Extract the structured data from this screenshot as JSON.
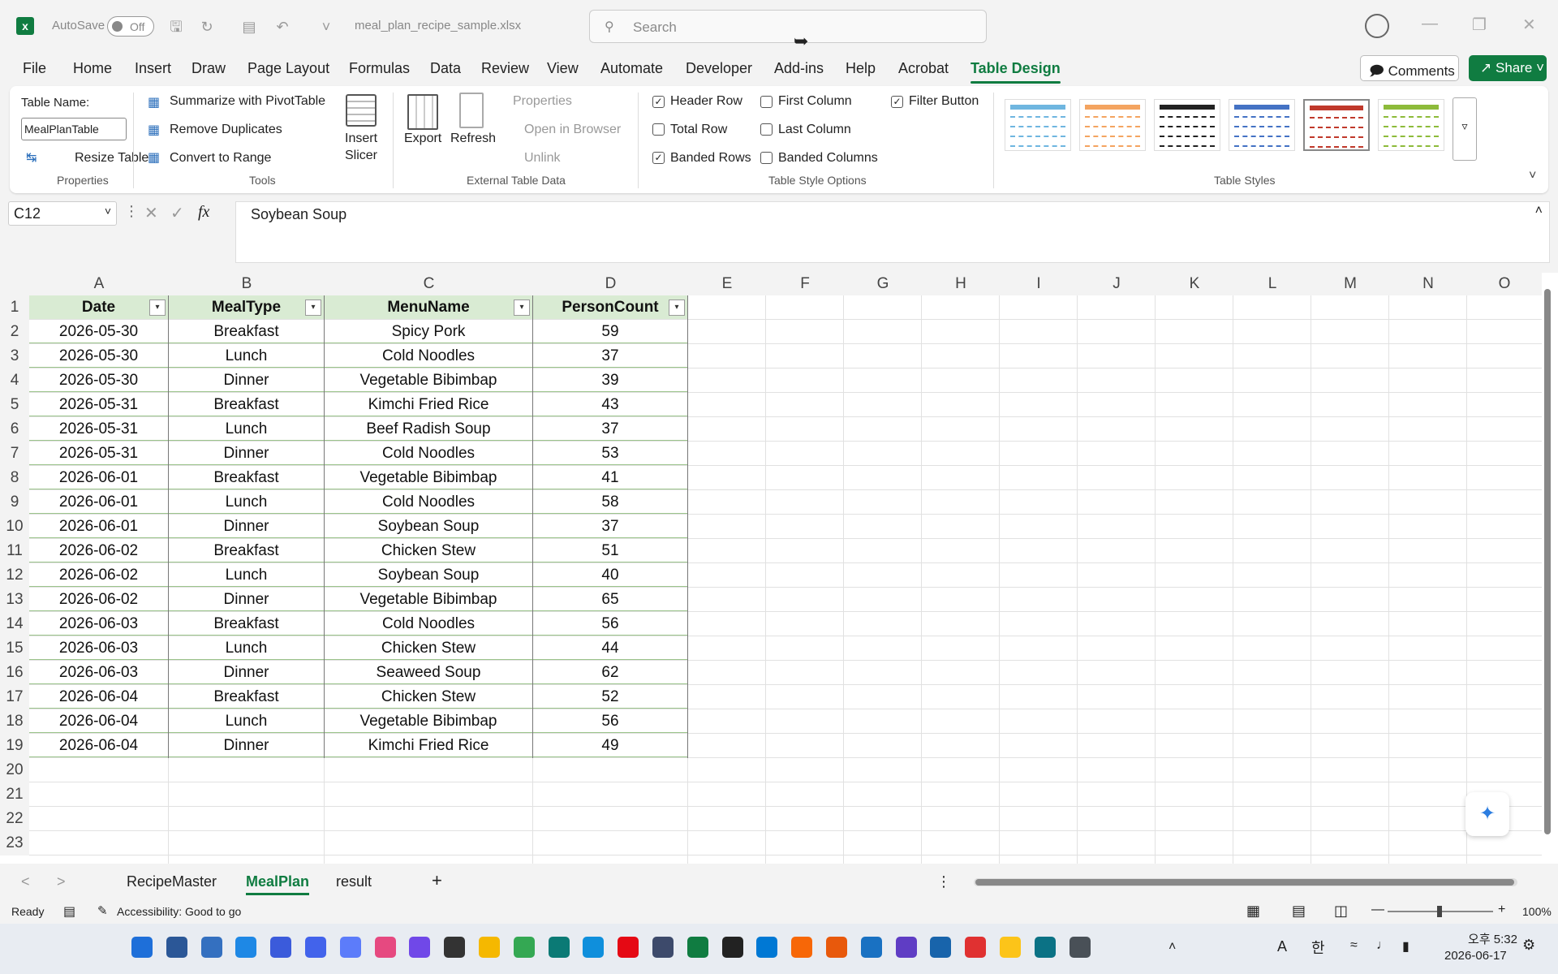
{
  "titlebar": {
    "autosave_label": "AutoSave",
    "autosave_state": "Off",
    "filename": "meal_plan_recipe_sample.xlsx",
    "search_placeholder": "Search"
  },
  "menu": {
    "tabs": [
      "File",
      "Home",
      "Insert",
      "Draw",
      "Page Layout",
      "Formulas",
      "Data",
      "Review",
      "View",
      "Automate",
      "Developer",
      "Add-ins",
      "Help",
      "Acrobat",
      "Table Design"
    ],
    "active": "Table Design",
    "comments": "Comments",
    "share": "Share"
  },
  "ribbon": {
    "properties": {
      "table_name_label": "Table Name:",
      "table_name": "MealPlanTable",
      "resize": "Resize Table",
      "group": "Properties"
    },
    "tools": {
      "pivot": "Summarize with PivotTable",
      "dupes": "Remove Duplicates",
      "convert": "Convert to Range",
      "slicer_1": "Insert",
      "slicer_2": "Slicer",
      "group": "Tools"
    },
    "external": {
      "export": "Export",
      "refresh": "Refresh",
      "properties": "Properties",
      "open": "Open in Browser",
      "unlink": "Unlink",
      "group": "External Table Data"
    },
    "options": {
      "header_row": "Header Row",
      "total_row": "Total Row",
      "banded_rows": "Banded Rows",
      "first_column": "First Column",
      "last_column": "Last Column",
      "banded_columns": "Banded Columns",
      "filter_button": "Filter Button",
      "group": "Table Style Options",
      "checked": {
        "header_row": true,
        "total_row": false,
        "banded_rows": true,
        "first_column": false,
        "last_column": false,
        "banded_columns": false,
        "filter_button": true
      }
    },
    "styles": {
      "group": "Table Styles",
      "swatch_colors": [
        "#6fb6e0",
        "#f4a460",
        "#222222",
        "#4472c4",
        "#c0392b",
        "#8dbb3a"
      ]
    }
  },
  "formula": {
    "cell_ref": "C12",
    "content": "Soybean Soup",
    "fx": "fx"
  },
  "sheet": {
    "columns": [
      "A",
      "B",
      "C",
      "D",
      "E",
      "F",
      "G",
      "H",
      "I",
      "J",
      "K",
      "L",
      "M",
      "N",
      "O"
    ],
    "rows": [
      "1",
      "2",
      "3",
      "4",
      "5",
      "6",
      "7",
      "8",
      "9",
      "10",
      "11",
      "12",
      "13",
      "14",
      "15",
      "16",
      "17",
      "18",
      "19",
      "20",
      "21",
      "22",
      "23"
    ],
    "headers": [
      "Date",
      "MealType",
      "MenuName",
      "PersonCount"
    ],
    "data": [
      [
        "2026-05-30",
        "Breakfast",
        "Spicy Pork",
        "59"
      ],
      [
        "2026-05-30",
        "Lunch",
        "Cold Noodles",
        "37"
      ],
      [
        "2026-05-30",
        "Dinner",
        "Vegetable Bibimbap",
        "39"
      ],
      [
        "2026-05-31",
        "Breakfast",
        "Kimchi Fried Rice",
        "43"
      ],
      [
        "2026-05-31",
        "Lunch",
        "Beef Radish Soup",
        "37"
      ],
      [
        "2026-05-31",
        "Dinner",
        "Cold Noodles",
        "53"
      ],
      [
        "2026-06-01",
        "Breakfast",
        "Vegetable Bibimbap",
        "41"
      ],
      [
        "2026-06-01",
        "Lunch",
        "Cold Noodles",
        "58"
      ],
      [
        "2026-06-01",
        "Dinner",
        "Soybean Soup",
        "37"
      ],
      [
        "2026-06-02",
        "Breakfast",
        "Chicken Stew",
        "51"
      ],
      [
        "2026-06-02",
        "Lunch",
        "Soybean Soup",
        "40"
      ],
      [
        "2026-06-02",
        "Dinner",
        "Vegetable Bibimbap",
        "65"
      ],
      [
        "2026-06-03",
        "Breakfast",
        "Cold Noodles",
        "56"
      ],
      [
        "2026-06-03",
        "Lunch",
        "Chicken Stew",
        "44"
      ],
      [
        "2026-06-03",
        "Dinner",
        "Seaweed Soup",
        "62"
      ],
      [
        "2026-06-04",
        "Breakfast",
        "Chicken Stew",
        "52"
      ],
      [
        "2026-06-04",
        "Lunch",
        "Vegetable Bibimbap",
        "56"
      ],
      [
        "2026-06-04",
        "Dinner",
        "Kimchi Fried Rice",
        "49"
      ]
    ]
  },
  "sheet_tabs": {
    "tabs": [
      "RecipeMaster",
      "MealPlan",
      "result"
    ],
    "active": "MealPlan"
  },
  "status": {
    "ready": "Ready",
    "accessibility": "Accessibility: Good to go",
    "zoom": "100%"
  },
  "clock": {
    "time": "오후 5:32",
    "date": "2026-06-17"
  },
  "colors": {
    "accent": "#107c41",
    "table_header": "#d9ebd3"
  }
}
